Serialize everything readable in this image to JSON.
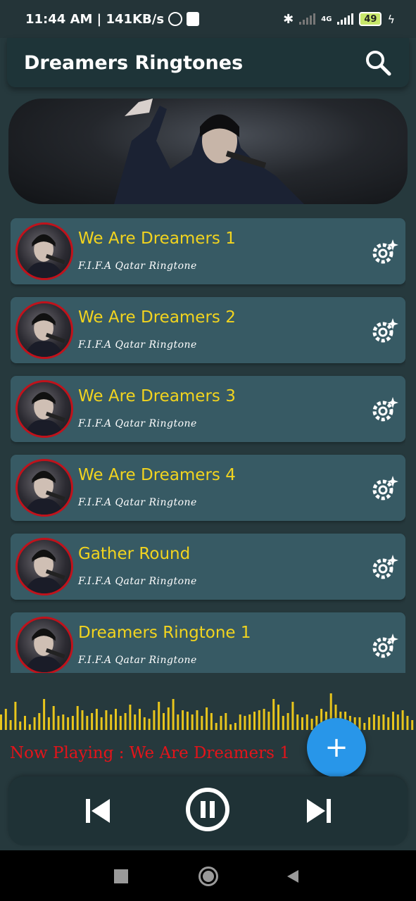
{
  "status_bar": {
    "time": "11:44 AM | 141KB/s",
    "network": "4G",
    "battery": "49"
  },
  "app_bar": {
    "title": "Dreamers Ringtones",
    "search_icon": "search-icon"
  },
  "songs": [
    {
      "title": "We Are Dreamers 1",
      "subtitle": "F.I.F.A Qatar Ringtone"
    },
    {
      "title": "We Are Dreamers 2",
      "subtitle": "F.I.F.A Qatar Ringtone"
    },
    {
      "title": "We Are Dreamers 3",
      "subtitle": "F.I.F.A Qatar Ringtone"
    },
    {
      "title": "We Are Dreamers 4",
      "subtitle": "F.I.F.A Qatar Ringtone"
    },
    {
      "title": "Gather Round",
      "subtitle": "F.I.F.A Qatar Ringtone"
    },
    {
      "title": "Dreamers Ringtone 1",
      "subtitle": "F.I.F.A Qatar Ringtone"
    }
  ],
  "player": {
    "now_playing": "Now Playing : We Are Dreamers 1",
    "fab_label": "+"
  },
  "colors": {
    "title_yellow": "#f2d41f",
    "now_playing_red": "#e3141a",
    "fab_blue": "#2896e9",
    "card_bg": "#375a64"
  }
}
